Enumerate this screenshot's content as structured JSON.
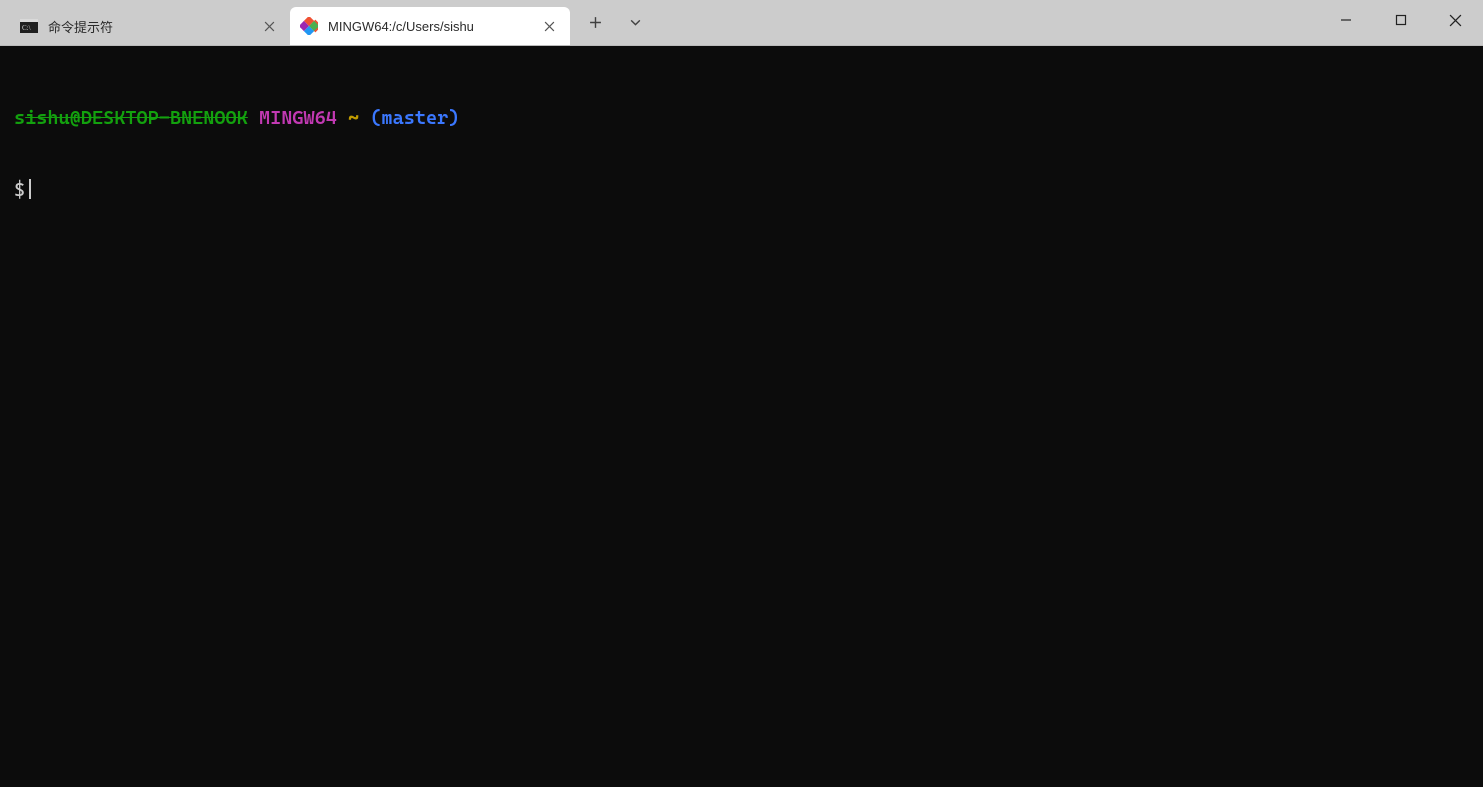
{
  "tabs": [
    {
      "title": "命令提示符",
      "active": false,
      "icon": "cmd-icon"
    },
    {
      "title": "MINGW64:/c/Users/sishu",
      "active": true,
      "icon": "git-bash-icon"
    }
  ],
  "terminal": {
    "prompt_user_prefix": "s",
    "prompt_user_redacted": "ishu@DESKTOP-BNENOOK",
    "prompt_system": "MINGW64",
    "prompt_path": "~",
    "prompt_branch": "(master)",
    "prompt_symbol": "$"
  },
  "colors": {
    "titlebar_bg": "#cccccc",
    "terminal_bg": "#0c0c0c",
    "user_green": "#13a10e",
    "sys_purple": "#c239b3",
    "path_yellow": "#c19c00",
    "branch_blue": "#3b78ff"
  }
}
